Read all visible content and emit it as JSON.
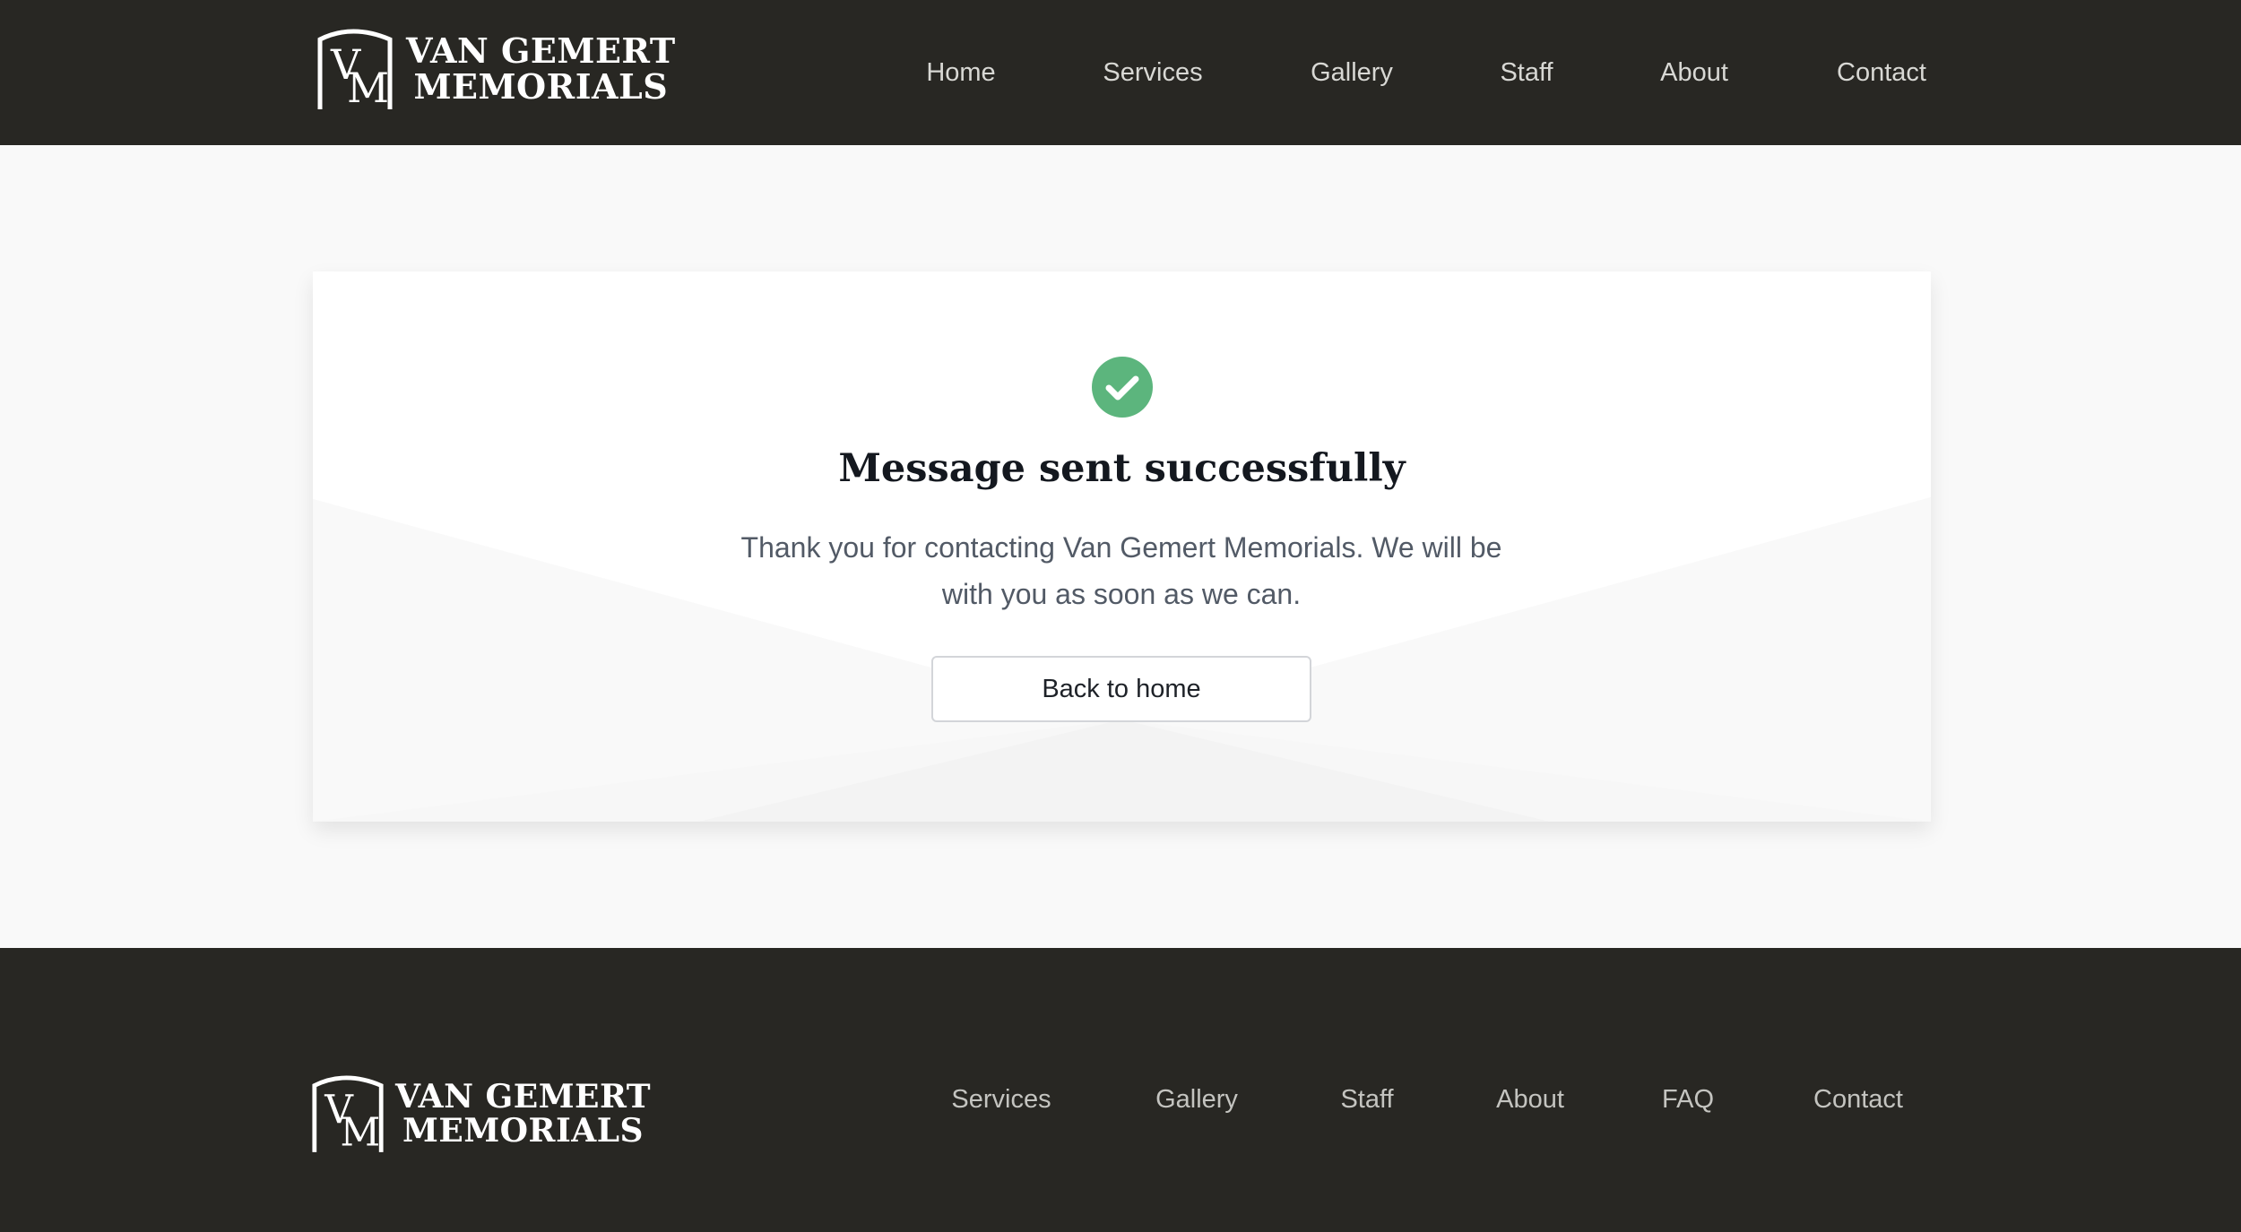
{
  "brand": {
    "line1": "VAN GEMERT",
    "line2": "MEMORIALS"
  },
  "header_nav": [
    {
      "label": "Home"
    },
    {
      "label": "Services"
    },
    {
      "label": "Gallery"
    },
    {
      "label": "Staff"
    },
    {
      "label": "About"
    },
    {
      "label": "Contact"
    }
  ],
  "confirmation": {
    "icon": "check-circle-icon",
    "title": "Message sent successfully",
    "message": "Thank you for contacting Van Gemert Memorials. We will be with you as soon as we can.",
    "button_label": "Back to home",
    "accent_color": "#5cb57d"
  },
  "footer_nav": [
    {
      "label": "Services"
    },
    {
      "label": "Gallery"
    },
    {
      "label": "Staff"
    },
    {
      "label": "About"
    },
    {
      "label": "FAQ"
    },
    {
      "label": "Contact"
    }
  ],
  "colors": {
    "header_bg": "#282723",
    "page_bg": "#f9f9f9",
    "card_bg": "#ffffff",
    "title_text": "#14181f",
    "body_text": "#525a66"
  }
}
